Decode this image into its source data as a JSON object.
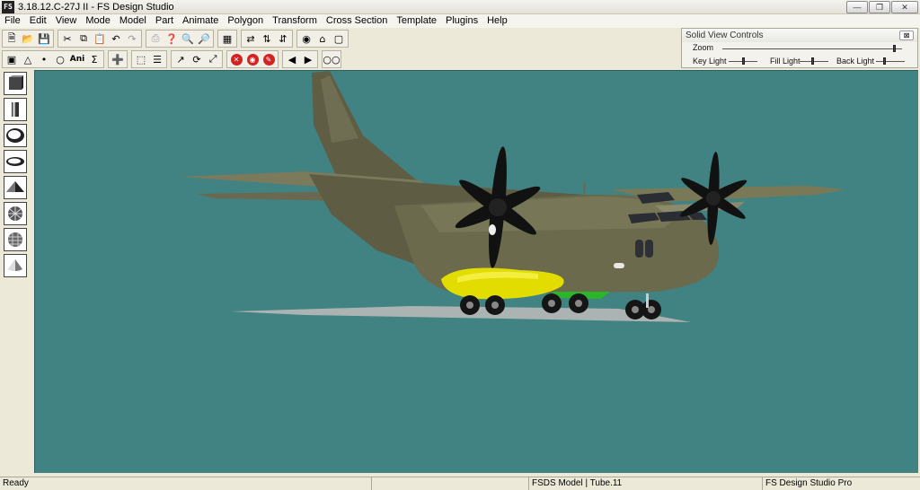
{
  "window": {
    "title": "3.18.12.C-27J II - FS Design Studio",
    "app_icon_label": "FS"
  },
  "menu": [
    "File",
    "Edit",
    "View",
    "Mode",
    "Model",
    "Part",
    "Animate",
    "Polygon",
    "Transform",
    "Cross Section",
    "Template",
    "Plugins",
    "Help"
  ],
  "toolbar1": [
    [
      "new-file-icon",
      "open-folder-icon",
      "save-icon"
    ],
    [
      "cut-icon",
      "copy-icon",
      "paste-icon",
      "undo-icon",
      "redo-icon"
    ],
    [
      "print-icon",
      "help-icon",
      "zoom-in-icon",
      "zoom-out-icon"
    ],
    [
      "grid-icon"
    ],
    [
      "flip-x-icon",
      "flip-y-icon",
      "flip-z-icon"
    ],
    [
      "eye-icon",
      "home-view-icon",
      "wireframe-icon"
    ]
  ],
  "toolbar2": {
    "ani_label": "Ani",
    "sigma_label": "Σ"
  },
  "solid_view_controls": {
    "title": "Solid View Controls",
    "close_label": "⊠",
    "zoom_label": "Zoom",
    "key_light_label": "Key Light",
    "fill_light_label": "Fill Light",
    "back_light_label": "Back Light",
    "zoom_level": 0.97,
    "key_light_level": 0.55,
    "fill_light_level": 0.45,
    "back_light_level": 0.3
  },
  "palette": [
    "cube-icon",
    "cylinder-icon",
    "sphere-icon",
    "ellipsoid-icon",
    "pyramid-icon",
    "geosphere-icon",
    "dome-sphere-icon",
    "cone-icon"
  ],
  "colors": {
    "viewport_bg": "#418282",
    "fuselage": "#6b6a4d",
    "propeller": "#111111",
    "yellow_tank": "#e6e000",
    "shadow": "#bdbdbd"
  },
  "status": {
    "ready": "Ready",
    "model_info": "FSDS Model | Tube.11",
    "product": "FS Design Studio Pro"
  }
}
